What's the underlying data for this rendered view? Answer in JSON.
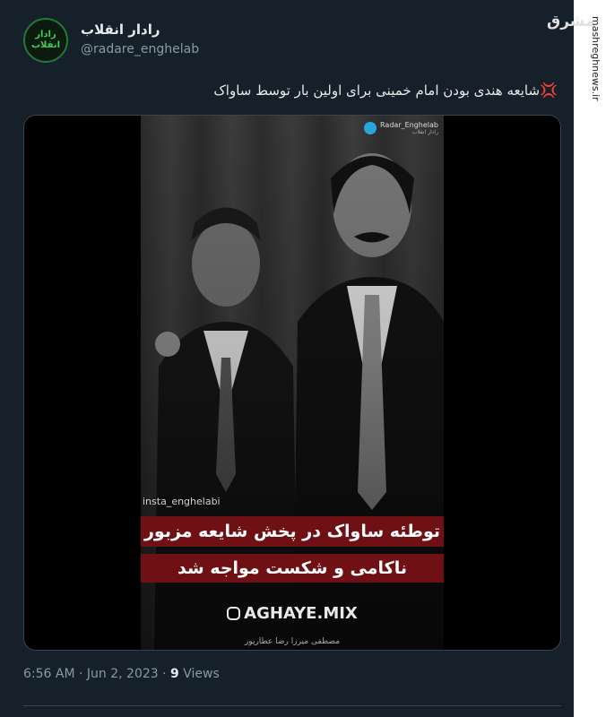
{
  "account": {
    "name": "رادار انقلاب",
    "handle": "@radare_enghelab",
    "avatar_text": [
      "رادار",
      "انقلاب"
    ],
    "avatar_color": "#1f7a32"
  },
  "tweet": {
    "emoji": "💢",
    "text": "شایعه هندی بودن امام خمینی برای اولین بار توسط ساواک"
  },
  "media": {
    "telegram_label": "Radar_Enghelab",
    "telegram_sub": "رادار انقلاب",
    "insta_tag": "insta_enghelabi",
    "caption_line1": "توطئه ساواک در پخش شایعه مزبور با",
    "caption_line2": "ناکامی و شکست مواجه شد",
    "brand": "AGHAYE.MIX",
    "names": "مصطفی میرزا    رضا عطارپور"
  },
  "meta": {
    "time": "6:56 AM",
    "sep": "·",
    "date": "Jun 2, 2023",
    "views_count": "9",
    "views_label": "Views"
  },
  "site": {
    "logo": "مشرق",
    "url": "mashreghnews.ir"
  },
  "colors": {
    "background": "#15202b",
    "caption_red": "#6e1014",
    "muted_text": "#8b98a5"
  }
}
